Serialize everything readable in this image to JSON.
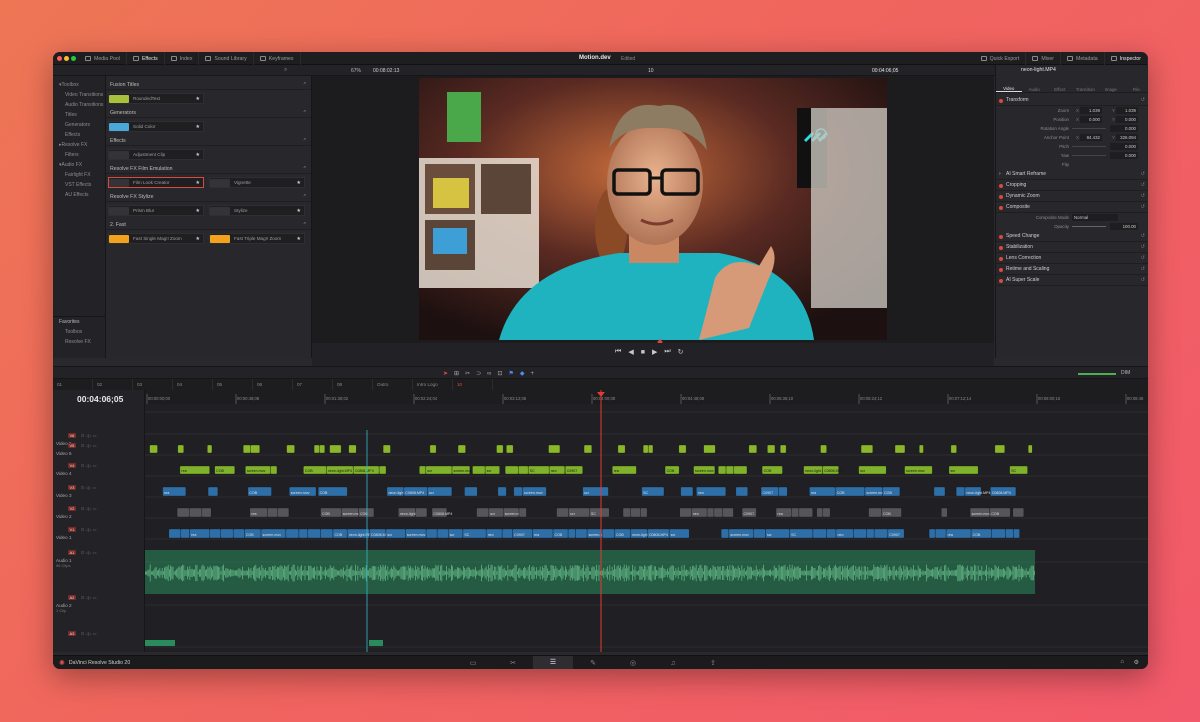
{
  "app": {
    "project_title": "Motion.dev",
    "edit_state": "Edited",
    "brand": "DaVinci Resolve Studio 20"
  },
  "toolbar": {
    "left": [
      {
        "label": "Media Pool",
        "icon": "media-pool-icon"
      },
      {
        "label": "Effects",
        "icon": "effects-icon",
        "active": true
      },
      {
        "label": "Index",
        "icon": "index-icon"
      },
      {
        "label": "Sound Library",
        "icon": "sound-library-icon"
      },
      {
        "label": "Keyframes",
        "icon": "keyframes-icon"
      }
    ],
    "right": [
      {
        "label": "Quick Export",
        "icon": "export-icon"
      },
      {
        "label": "Mixer",
        "icon": "mixer-icon"
      },
      {
        "label": "Metadata",
        "icon": "metadata-icon"
      },
      {
        "label": "Inspector",
        "icon": "inspector-icon",
        "active": true
      }
    ]
  },
  "viewer": {
    "zoom": "67%",
    "source_tc": "00:08:02:13",
    "frame_count": "10",
    "timecode": "00:04:06;05",
    "clip_name": "neon-light.MP4"
  },
  "effects_tree": [
    {
      "label": "Toolbox",
      "level": 0,
      "open": true
    },
    {
      "label": "Video Transitions",
      "level": 1
    },
    {
      "label": "Audio Transitions",
      "level": 1
    },
    {
      "label": "Titles",
      "level": 1
    },
    {
      "label": "Generators",
      "level": 1
    },
    {
      "label": "Effects",
      "level": 1
    },
    {
      "label": "Resolve FX",
      "level": 0
    },
    {
      "label": "Filters",
      "level": 1
    },
    {
      "label": "Audio FX",
      "level": 0,
      "open": true
    },
    {
      "label": "Fairlight FX",
      "level": 1
    },
    {
      "label": "VST Effects",
      "level": 1
    },
    {
      "label": "AU Effects",
      "level": 1
    }
  ],
  "favorites": {
    "title": "Favorites",
    "items": [
      "Toolbox",
      "Resolve FX"
    ]
  },
  "effects_sections": [
    {
      "title": "Fusion Titles",
      "items": [
        {
          "label": "RoundedText",
          "thumb": "#a9c13a"
        }
      ]
    },
    {
      "title": "Generators",
      "items": [
        {
          "label": "Solid Color",
          "thumb": "#4aa7d8"
        }
      ]
    },
    {
      "title": "Effects",
      "items": [
        {
          "label": "Adjustment Clip",
          "thumb": "#333338"
        }
      ]
    },
    {
      "title": "Resolve FX Film Emulation",
      "items": [
        {
          "label": "Film Look Creator",
          "thumb": "#333338",
          "selected": true
        },
        {
          "label": "Vignette",
          "thumb": "#333338"
        }
      ]
    },
    {
      "title": "Resolve FX Stylize",
      "items": [
        {
          "label": "Prism Blur",
          "thumb": "#333338"
        },
        {
          "label": "Stylize",
          "thumb": "#333338"
        }
      ]
    },
    {
      "title": "2. Fast",
      "items": [
        {
          "label": "Fast Single Mag!! Zoom",
          "thumb": "#f3a21c"
        },
        {
          "label": "Fast Triple Mag!! Zoom",
          "thumb": "#f3a21c"
        }
      ]
    }
  ],
  "inspector": {
    "tabs": [
      "Video",
      "Audio",
      "Effect",
      "Transition",
      "Image",
      "File"
    ],
    "transform_title": "Transform",
    "params": [
      {
        "label": "Zoom",
        "x_axis": "X",
        "x": "1.039",
        "y_axis": "Y",
        "y": "1.039"
      },
      {
        "label": "Position",
        "x_axis": "X",
        "x": "0.000",
        "y_axis": "Y",
        "y": "0.000"
      },
      {
        "label": "Rotation Angle",
        "v": "0.000"
      },
      {
        "label": "Anchor Point",
        "x_axis": "X",
        "x": "84.432",
        "y_axis": "Y",
        "y": "326.094"
      },
      {
        "label": "Pitch",
        "v": "0.000"
      },
      {
        "label": "Yaw",
        "v": "0.000"
      },
      {
        "label": "Flip",
        "v": ""
      }
    ],
    "sections_a": [
      "AI Smart Reframe",
      "Cropping",
      "Dynamic Zoom"
    ],
    "composite": {
      "title": "Composite",
      "mode_label": "Composite Mode",
      "mode": "Normal",
      "opacity_label": "Opacity",
      "opacity": "100.00"
    },
    "sections_b": [
      "Speed Change",
      "Stabilization",
      "Lens Correction",
      "Retime and Scaling",
      "AI Super Scale"
    ]
  },
  "timeline": {
    "timecode": "00:04:06;05",
    "tabs": [
      "01",
      "02",
      "03",
      "04",
      "05",
      "06",
      "07",
      "08",
      "Outro",
      "Intro Logo",
      "10"
    ],
    "ruler": [
      "00:00:00;00",
      "00:00:48;08",
      "00:01:36;02",
      "00:02:24;04",
      "00:03:12;06",
      "00:04:00;08",
      "00:04:48;08",
      "00:05:36;10",
      "00:06:24;12",
      "00:07:12;14",
      "00:08:00;16",
      "00:08:48"
    ],
    "tracks": [
      {
        "badge": "V6",
        "name": "Video 6"
      },
      {
        "badge": "V5",
        "name": "Video 5"
      },
      {
        "badge": "V4",
        "name": "Video 4"
      },
      {
        "badge": "V3",
        "name": "Video 3"
      },
      {
        "badge": "V2",
        "name": "Video 2"
      },
      {
        "badge": "V1",
        "name": "Video 1"
      },
      {
        "badge": "A1",
        "name": "Audio 1",
        "sub": "96 Clips",
        "level": "2.0"
      },
      {
        "badge": "A2",
        "name": "Audio 2",
        "sub": "1 Clip",
        "level": "2.0"
      },
      {
        "badge": "A3",
        "name": ""
      }
    ],
    "clip_labels": [
      "rea",
      "COB",
      "screen.mov",
      "COB",
      "neon-light.MP4",
      "C0808.MP4",
      "scr",
      "screen.mov",
      "scr",
      "SC",
      "neo",
      "C0907"
    ],
    "volume_label": "DIM"
  },
  "pages": [
    "media-page-icon",
    "cut-page-icon",
    "edit-page-icon",
    "fusion-page-icon",
    "color-page-icon",
    "fairlight-page-icon",
    "deliver-page-icon"
  ]
}
